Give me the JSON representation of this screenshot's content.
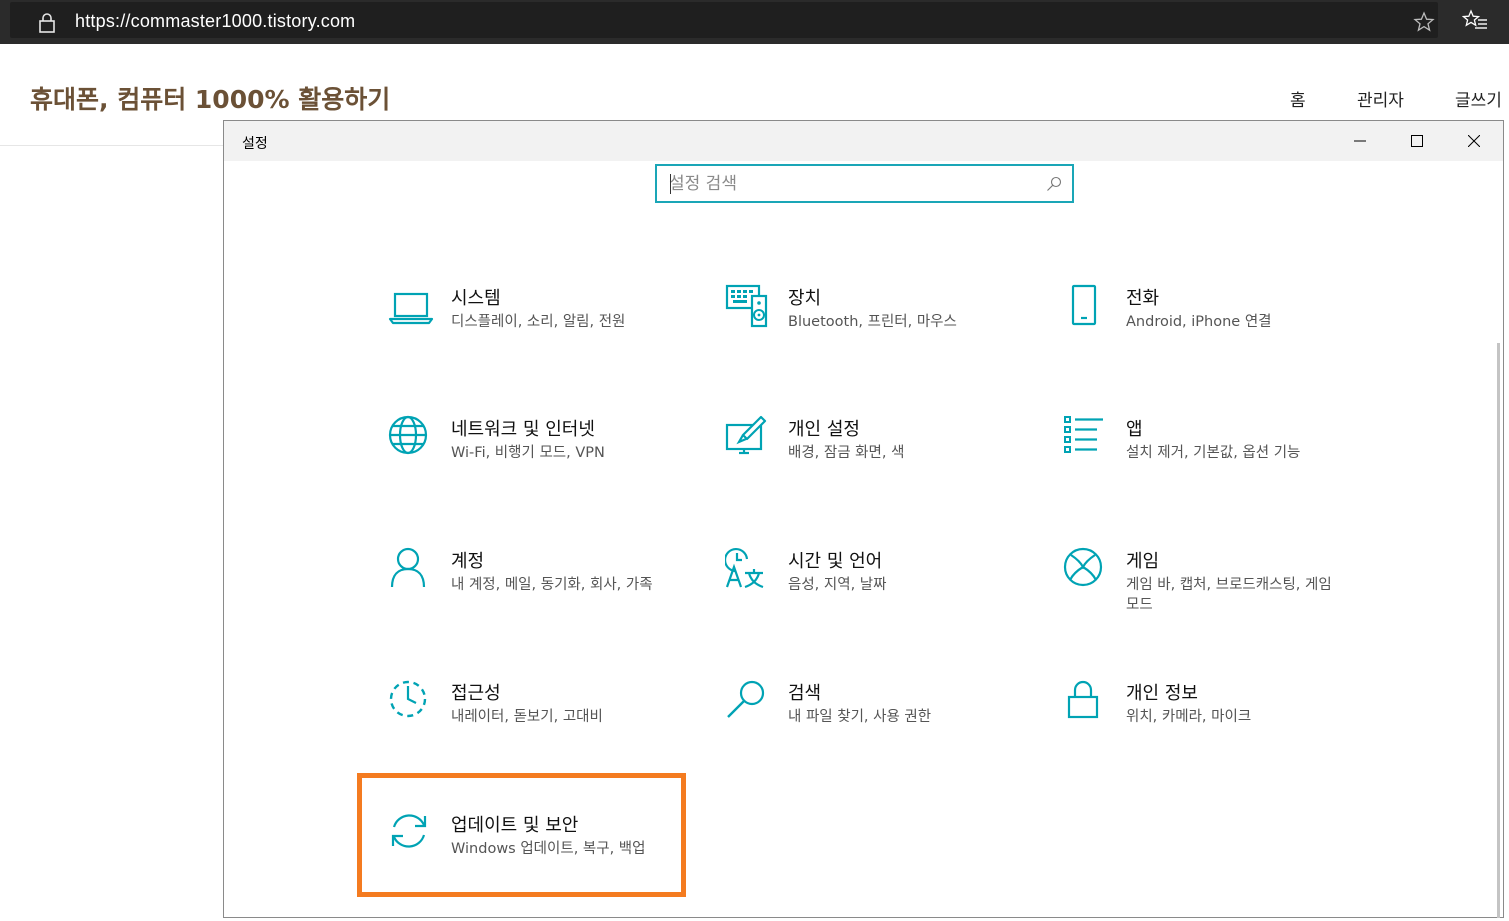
{
  "browser": {
    "url_scheme": "https://",
    "url_host": "commaster1000.tistory.com"
  },
  "blog": {
    "title": "휴대폰, 컴퓨터 1000% 활용하기",
    "nav": {
      "home": "홈",
      "admin": "관리자",
      "write": "글쓰기"
    }
  },
  "settings": {
    "window_title": "설정",
    "search": {
      "placeholder": "설정 검색"
    },
    "tiles": [
      {
        "title": "시스템",
        "desc": "디스플레이, 소리, 알림, 전원",
        "icon": "laptop-icon"
      },
      {
        "title": "장치",
        "desc": "Bluetooth, 프린터, 마우스",
        "icon": "devices-icon"
      },
      {
        "title": "전화",
        "desc": "Android, iPhone 연결",
        "icon": "phone-icon"
      },
      {
        "title": "네트워크 및 인터넷",
        "desc": "Wi-Fi, 비행기 모드, VPN",
        "icon": "globe-icon"
      },
      {
        "title": "개인 설정",
        "desc": "배경, 잠금 화면, 색",
        "icon": "personalization-icon"
      },
      {
        "title": "앱",
        "desc": "설치 제거, 기본값, 옵션 기능",
        "icon": "apps-list-icon"
      },
      {
        "title": "계정",
        "desc": "내 계정, 메일, 동기화, 회사, 가족",
        "icon": "person-icon"
      },
      {
        "title": "시간 및 언어",
        "desc": "음성, 지역, 날짜",
        "icon": "time-language-icon"
      },
      {
        "title": "게임",
        "desc": "게임 바, 캡처, 브로드캐스팅, 게임 모드",
        "icon": "xbox-icon"
      },
      {
        "title": "접근성",
        "desc": "내레이터, 돋보기, 고대비",
        "icon": "ease-of-access-icon"
      },
      {
        "title": "검색",
        "desc": "내 파일 찾기, 사용 권한",
        "icon": "search-magnifier-icon"
      },
      {
        "title": "개인 정보",
        "desc": "위치, 카메라, 마이크",
        "icon": "lock-privacy-icon"
      },
      {
        "title": "업데이트 및 보안",
        "desc": "Windows 업데이트, 복구, 백업",
        "icon": "sync-update-icon"
      }
    ]
  },
  "colors": {
    "accent": "#00a3b4",
    "highlight": "#f47b20",
    "blog_title": "#6b5136"
  }
}
